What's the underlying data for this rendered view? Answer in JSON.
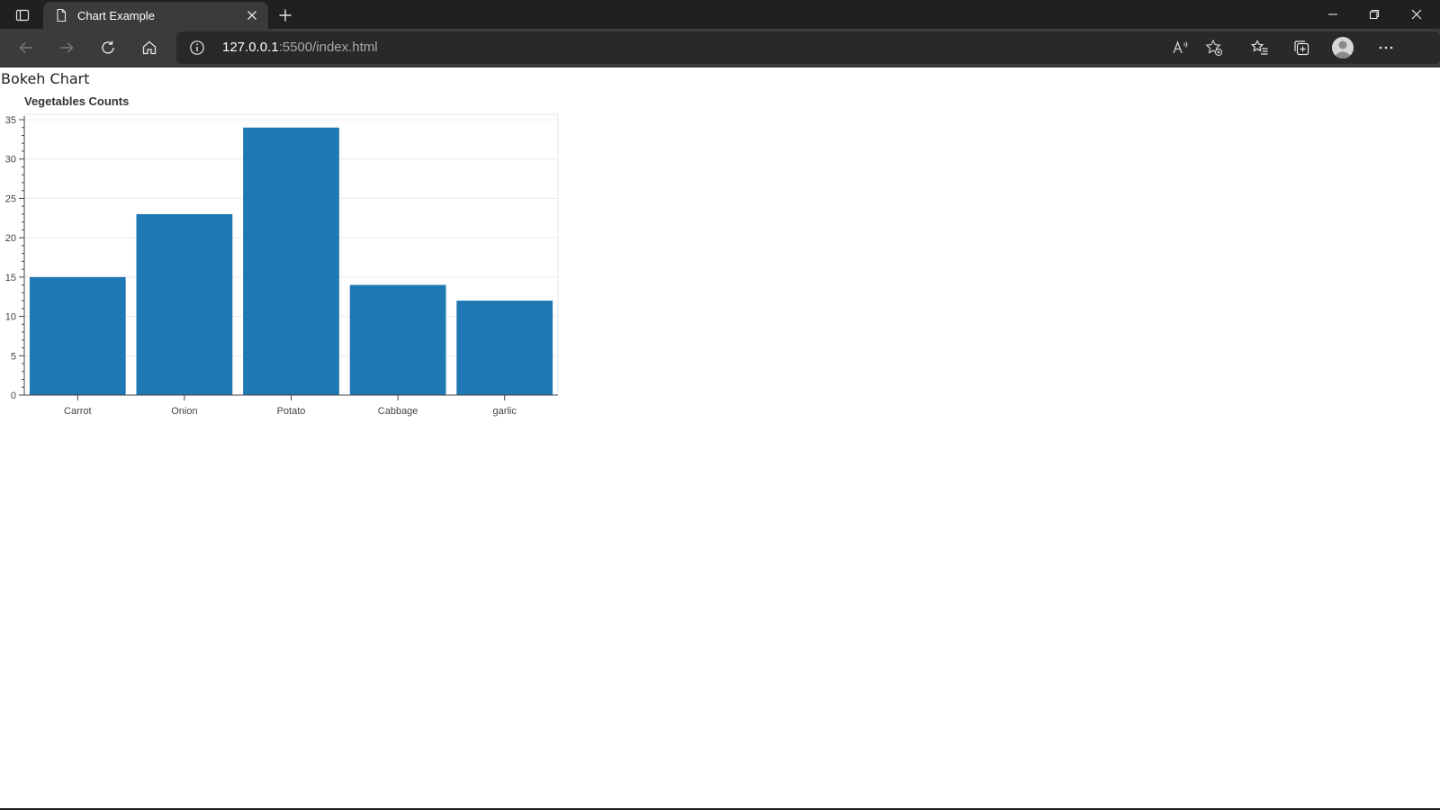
{
  "browser": {
    "tab": {
      "title": "Chart Example",
      "close_icon": "close-icon",
      "favicon": "page-icon"
    },
    "new_tab_icon": "plus-icon",
    "address": {
      "host": "127.0.0.1",
      "rest": ":5500/index.html"
    },
    "toolbar_icons": [
      "back-arrow-icon",
      "forward-arrow-icon",
      "refresh-icon",
      "home-icon",
      "read-aloud-icon",
      "add-favorite-icon",
      "favorites-icon",
      "collections-icon",
      "profile-icon",
      "more-icon"
    ],
    "window_controls": [
      "minimize-icon",
      "restore-icon",
      "close-icon"
    ]
  },
  "page": {
    "heading": "Bokeh Chart"
  },
  "colors": {
    "bar": "#1f77b4",
    "chrome_dark": "#202020",
    "chrome_toolbar": "#3b3b3b"
  },
  "chart_data": {
    "type": "bar",
    "title": "Vegetables Counts",
    "categories": [
      "Carrot",
      "Onion",
      "Potato",
      "Cabbage",
      "garlic"
    ],
    "values": [
      15,
      23,
      34,
      14,
      12
    ],
    "xlabel": "",
    "ylabel": "",
    "ylim": [
      0,
      35
    ],
    "yticks": [
      0,
      5,
      10,
      15,
      20,
      25,
      30,
      35
    ],
    "grid": true,
    "legend": false
  }
}
